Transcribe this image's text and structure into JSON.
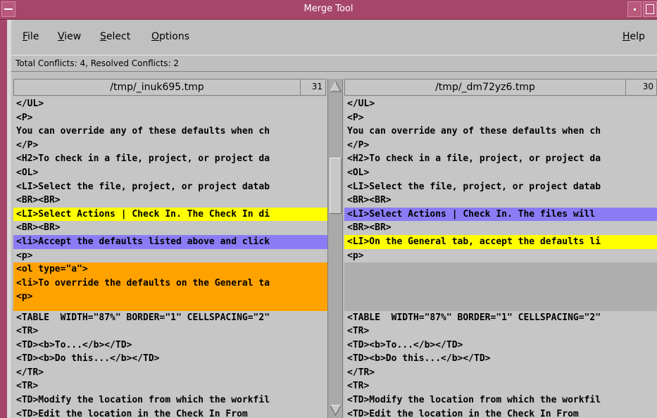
{
  "window": {
    "title": "Merge Tool"
  },
  "menu": {
    "file": "File",
    "view": "View",
    "select": "Select",
    "options": "Options",
    "help": "Help"
  },
  "status": {
    "text": "Total Conflicts: 4, Resolved Conflicts: 2"
  },
  "left_pane": {
    "filename": "/tmp/_inuk695.tmp",
    "count": "31",
    "lines": [
      {
        "text": "</UL>",
        "hl": ""
      },
      {
        "text": "<P>",
        "hl": ""
      },
      {
        "text": "You can override any of these defaults when ch",
        "hl": ""
      },
      {
        "text": "</P>",
        "hl": ""
      },
      {
        "text": "<H2>To check in a file, project, or project da",
        "hl": ""
      },
      {
        "text": "<OL>",
        "hl": ""
      },
      {
        "text": "<LI>Select the file, project, or project datab",
        "hl": ""
      },
      {
        "text": "<BR><BR>",
        "hl": ""
      },
      {
        "text": "<LI>Select Actions | Check In. The Check In di",
        "hl": "yellow"
      },
      {
        "text": "<BR><BR>",
        "hl": ""
      },
      {
        "text": "<li>Accept the defaults listed above and click",
        "hl": "blue"
      },
      {
        "text": "<p>",
        "hl": ""
      },
      {
        "text": "<ol type=\"a\">",
        "hl": "orange"
      },
      {
        "text": "<li>To override the defaults on the General ta",
        "hl": "orange"
      },
      {
        "text": "<p>",
        "hl": "orange"
      },
      {
        "text": "",
        "hl": "orange-pad"
      },
      {
        "text": "<TABLE  WIDTH=\"87%\" BORDER=\"1\" CELLSPACING=\"2\"",
        "hl": ""
      },
      {
        "text": "<TR>",
        "hl": ""
      },
      {
        "text": "<TD><b>To...</b></TD>",
        "hl": ""
      },
      {
        "text": "<TD><b>Do this...</b></TD>",
        "hl": ""
      },
      {
        "text": "</TR>",
        "hl": ""
      },
      {
        "text": "<TR>",
        "hl": ""
      },
      {
        "text": "<TD>Modify the location from which the workfil",
        "hl": ""
      },
      {
        "text": "<TD>Edit the location in the Check In From",
        "hl": ""
      }
    ]
  },
  "right_pane": {
    "filename": "/tmp/_dm72yz6.tmp",
    "count": "30",
    "lines": [
      {
        "text": "</UL>",
        "hl": ""
      },
      {
        "text": "<P>",
        "hl": ""
      },
      {
        "text": "You can override any of these defaults when ch",
        "hl": ""
      },
      {
        "text": "</P>",
        "hl": ""
      },
      {
        "text": "<H2>To check in a file, project, or project da",
        "hl": ""
      },
      {
        "text": "<OL>",
        "hl": ""
      },
      {
        "text": "<LI>Select the file, project, or project datab",
        "hl": ""
      },
      {
        "text": "<BR><BR>",
        "hl": ""
      },
      {
        "text": "<LI>Select Actions | Check In. The files will",
        "hl": "blue"
      },
      {
        "text": "<BR><BR>",
        "hl": ""
      },
      {
        "text": "<LI>On the General tab, accept the defaults li",
        "hl": "yellow"
      },
      {
        "text": "<p>",
        "hl": ""
      },
      {
        "text": "",
        "hl": "gray"
      },
      {
        "text": "",
        "hl": "gray"
      },
      {
        "text": "",
        "hl": "gray"
      },
      {
        "text": "",
        "hl": "gray-pad"
      },
      {
        "text": "<TABLE  WIDTH=\"87%\" BORDER=\"1\" CELLSPACING=\"2\"",
        "hl": ""
      },
      {
        "text": "<TR>",
        "hl": ""
      },
      {
        "text": "<TD><b>To...</b></TD>",
        "hl": ""
      },
      {
        "text": "<TD><b>Do this...</b></TD>",
        "hl": ""
      },
      {
        "text": "</TR>",
        "hl": ""
      },
      {
        "text": "<TR>",
        "hl": ""
      },
      {
        "text": "<TD>Modify the location from which the workfil",
        "hl": ""
      },
      {
        "text": "<TD>Edit the location in the Check In From",
        "hl": ""
      }
    ]
  },
  "colors": {
    "titlebar": "#a6466a",
    "yellow_conflict": "#ffff00",
    "blue_conflict": "#8b7cf6",
    "orange_conflict": "#ffa200",
    "gray_placeholder": "#aeaeae",
    "background": "#c6c6c6"
  }
}
